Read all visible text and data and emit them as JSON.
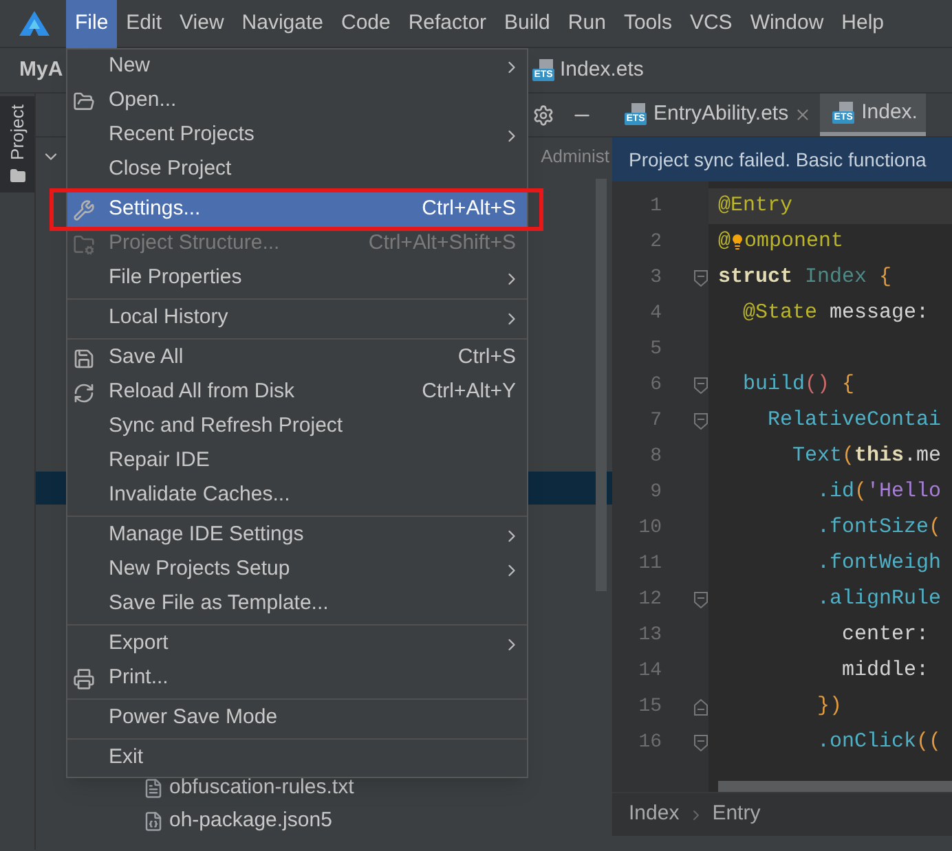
{
  "menubar": {
    "items": [
      {
        "label": "File",
        "selected": true
      },
      {
        "label": "Edit",
        "selected": false
      },
      {
        "label": "View",
        "selected": false
      },
      {
        "label": "Navigate",
        "selected": false
      },
      {
        "label": "Code",
        "selected": false
      },
      {
        "label": "Refactor",
        "selected": false
      },
      {
        "label": "Build",
        "selected": false
      },
      {
        "label": "Run",
        "selected": false
      },
      {
        "label": "Tools",
        "selected": false
      },
      {
        "label": "VCS",
        "selected": false
      },
      {
        "label": "Window",
        "selected": false
      },
      {
        "label": "Help",
        "selected": false
      }
    ]
  },
  "nav": {
    "project": "MyA",
    "file": {
      "badge": "ETS",
      "name": "Index.ets"
    }
  },
  "tool_strip": {
    "buttons": [
      {
        "label": "Project",
        "selected": true
      }
    ]
  },
  "project_panel": {
    "path_fragment": "Administ",
    "rows": [
      {
        "selected": true
      },
      {
        "name": "obfuscation-rules.txt",
        "selected": false
      },
      {
        "name": "oh-package.json5",
        "selected": false
      }
    ]
  },
  "editor": {
    "tabs": [
      {
        "badge": "ETS",
        "label": "EntryAbility.ets",
        "selected": false,
        "closable": true
      },
      {
        "badge": "ETS",
        "label": "Index.",
        "selected": true,
        "closable": false
      }
    ],
    "banner": "Project sync failed. Basic functiona",
    "lines": [
      {
        "number": "1",
        "current": true,
        "fold_start": false,
        "fold_end": false,
        "tokens": [
          {
            "text": "@Entry",
            "kind": "anno"
          }
        ]
      },
      {
        "number": "2",
        "current": false,
        "fold_start": false,
        "fold_end": false,
        "bulb": true,
        "tokens": [
          {
            "text": "@",
            "kind": "anno"
          },
          {
            "text": "omponent",
            "kind": "anno"
          }
        ]
      },
      {
        "number": "3",
        "current": false,
        "fold_start": true,
        "fold_end": false,
        "tokens": [
          {
            "text": "struct",
            "kind": "kw"
          },
          {
            "text": " Index",
            "kind": "dim"
          },
          {
            "text": " {",
            "kind": "brace"
          }
        ]
      },
      {
        "number": "4",
        "current": false,
        "fold_start": false,
        "fold_end": false,
        "tokens": [
          {
            "text": "  @State",
            "kind": "anno"
          },
          {
            "text": " message:",
            "kind": "plain"
          }
        ]
      },
      {
        "number": "5",
        "current": false,
        "fold_start": false,
        "fold_end": false
      },
      {
        "number": "6",
        "current": false,
        "fold_start": true,
        "fold_end": false,
        "tokens": [
          {
            "text": "  build",
            "kind": "fn"
          },
          {
            "text": "()",
            "kind": "paren"
          },
          {
            "text": " {",
            "kind": "brace"
          }
        ]
      },
      {
        "number": "7",
        "current": false,
        "fold_start": true,
        "fold_end": false,
        "tokens": [
          {
            "text": "    RelativeContai",
            "kind": "fn"
          }
        ]
      },
      {
        "number": "8",
        "current": false,
        "fold_start": false,
        "fold_end": false,
        "tokens": [
          {
            "text": "      Text",
            "kind": "fn"
          },
          {
            "text": "(",
            "kind": "brace"
          },
          {
            "text": "this",
            "kind": "kw"
          },
          {
            "text": ".me",
            "kind": "plain"
          }
        ]
      },
      {
        "number": "9",
        "current": false,
        "fold_start": false,
        "fold_end": false,
        "tokens": [
          {
            "text": "        .id",
            "kind": "fn"
          },
          {
            "text": "(",
            "kind": "brace"
          },
          {
            "text": "'Hello",
            "kind": "str"
          }
        ]
      },
      {
        "number": "10",
        "current": false,
        "fold_start": false,
        "fold_end": false,
        "tokens": [
          {
            "text": "        .fontSize",
            "kind": "fn"
          },
          {
            "text": "(",
            "kind": "brace"
          }
        ]
      },
      {
        "number": "11",
        "current": false,
        "fold_start": false,
        "fold_end": false,
        "tokens": [
          {
            "text": "        .fontWeigh",
            "kind": "fn"
          }
        ]
      },
      {
        "number": "12",
        "current": false,
        "fold_start": true,
        "fold_end": false,
        "tokens": [
          {
            "text": "        .alignRule",
            "kind": "fn"
          }
        ]
      },
      {
        "number": "13",
        "current": false,
        "fold_start": false,
        "fold_end": false,
        "tokens": [
          {
            "text": "          center:",
            "kind": "plain"
          }
        ]
      },
      {
        "number": "14",
        "current": false,
        "fold_start": false,
        "fold_end": false,
        "tokens": [
          {
            "text": "          middle:",
            "kind": "plain"
          }
        ]
      },
      {
        "number": "15",
        "current": false,
        "fold_start": false,
        "fold_end": true,
        "tokens": [
          {
            "text": "        })",
            "kind": "brace"
          }
        ]
      },
      {
        "number": "16",
        "current": false,
        "fold_start": true,
        "fold_end": false,
        "tokens": [
          {
            "text": "        .onClick",
            "kind": "fn"
          },
          {
            "text": "((",
            "kind": "brace"
          }
        ]
      }
    ],
    "breadcrumbs": [
      "Index",
      "Entry"
    ]
  },
  "file_menu": {
    "items": [
      {
        "kind": "item",
        "label": "New",
        "submenu": true,
        "disabled": false,
        "selected": false,
        "outlined": false
      },
      {
        "kind": "item",
        "label": "Open...",
        "submenu": false,
        "disabled": false,
        "selected": false,
        "outlined": false
      },
      {
        "kind": "item",
        "label": "Recent Projects",
        "submenu": true,
        "disabled": false,
        "selected": false,
        "outlined": false
      },
      {
        "kind": "item",
        "label": "Close Project",
        "submenu": false,
        "disabled": false,
        "selected": false,
        "outlined": false
      },
      {
        "kind": "separator"
      },
      {
        "kind": "item",
        "label": "Settings...",
        "shortcut": "Ctrl+Alt+S",
        "submenu": false,
        "disabled": false,
        "selected": true,
        "outlined": true
      },
      {
        "kind": "item",
        "label": "Project Structure...",
        "shortcut": "Ctrl+Alt+Shift+S",
        "submenu": false,
        "disabled": true,
        "selected": false,
        "outlined": false
      },
      {
        "kind": "item",
        "label": "File Properties",
        "submenu": true,
        "disabled": false,
        "selected": false,
        "outlined": false
      },
      {
        "kind": "separator"
      },
      {
        "kind": "item",
        "label": "Local History",
        "submenu": true,
        "disabled": false,
        "selected": false,
        "outlined": false
      },
      {
        "kind": "separator"
      },
      {
        "kind": "item",
        "label": "Save All",
        "shortcut": "Ctrl+S",
        "submenu": false,
        "disabled": false,
        "selected": false,
        "outlined": false
      },
      {
        "kind": "item",
        "label": "Reload All from Disk",
        "shortcut": "Ctrl+Alt+Y",
        "submenu": false,
        "disabled": false,
        "selected": false,
        "outlined": false
      },
      {
        "kind": "item",
        "label": "Sync and Refresh Project",
        "submenu": false,
        "disabled": false,
        "selected": false,
        "outlined": false
      },
      {
        "kind": "item",
        "label": "Repair IDE",
        "submenu": false,
        "disabled": false,
        "selected": false,
        "outlined": false
      },
      {
        "kind": "item",
        "label": "Invalidate Caches...",
        "submenu": false,
        "disabled": false,
        "selected": false,
        "outlined": false
      },
      {
        "kind": "separator"
      },
      {
        "kind": "item",
        "label": "Manage IDE Settings",
        "submenu": true,
        "disabled": false,
        "selected": false,
        "outlined": false
      },
      {
        "kind": "item",
        "label": "New Projects Setup",
        "submenu": true,
        "disabled": false,
        "selected": false,
        "outlined": false
      },
      {
        "kind": "item",
        "label": "Save File as Template...",
        "submenu": false,
        "disabled": false,
        "selected": false,
        "outlined": false
      },
      {
        "kind": "separator"
      },
      {
        "kind": "item",
        "label": "Export",
        "submenu": true,
        "disabled": false,
        "selected": false,
        "outlined": false
      },
      {
        "kind": "item",
        "label": "Print...",
        "submenu": false,
        "disabled": false,
        "selected": false,
        "outlined": false
      },
      {
        "kind": "separator"
      },
      {
        "kind": "item",
        "label": "Power Save Mode",
        "submenu": false,
        "disabled": false,
        "selected": false,
        "outlined": false
      },
      {
        "kind": "separator"
      },
      {
        "kind": "item",
        "label": "Exit",
        "submenu": false,
        "disabled": false,
        "selected": false,
        "outlined": false
      }
    ]
  }
}
